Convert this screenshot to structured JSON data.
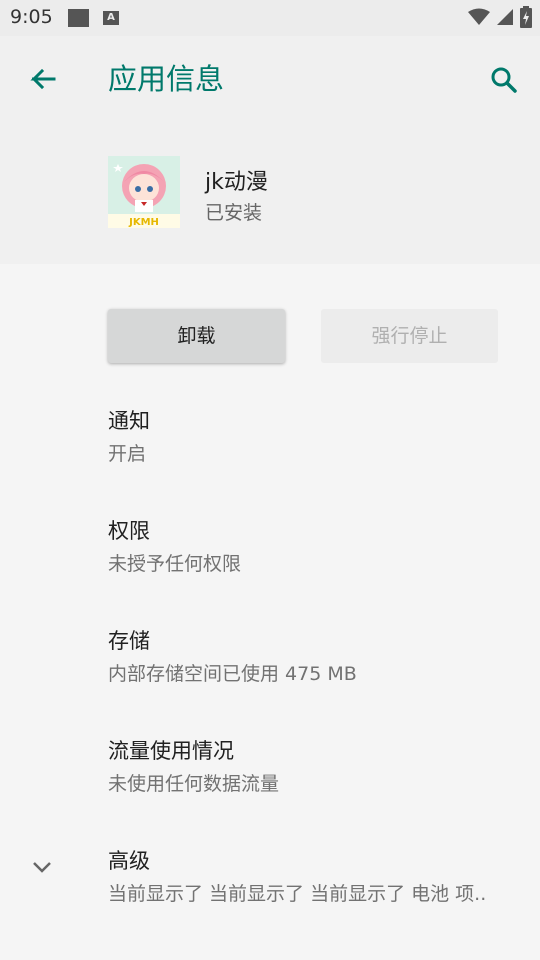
{
  "status_bar": {
    "time": "9:05",
    "a_badge": "A"
  },
  "header": {
    "title": "应用信息"
  },
  "app": {
    "name": "jk动漫",
    "status": "已安装",
    "icon_label": "JKMH"
  },
  "buttons": {
    "uninstall": "卸载",
    "force_stop": "强行停止"
  },
  "items": [
    {
      "title": "通知",
      "subtitle": "开启"
    },
    {
      "title": "权限",
      "subtitle": "未授予任何权限"
    },
    {
      "title": "存储",
      "subtitle": "内部存储空间已使用 475 MB"
    },
    {
      "title": "流量使用情况",
      "subtitle": "未使用任何数据流量"
    },
    {
      "title": "高级",
      "subtitle": "当前显示了 当前显示了 当前显示了 电池 项.."
    }
  ],
  "colors": {
    "accent": "#00796b",
    "background": "#f5f5f5",
    "header_bg": "#f0f0f0"
  }
}
